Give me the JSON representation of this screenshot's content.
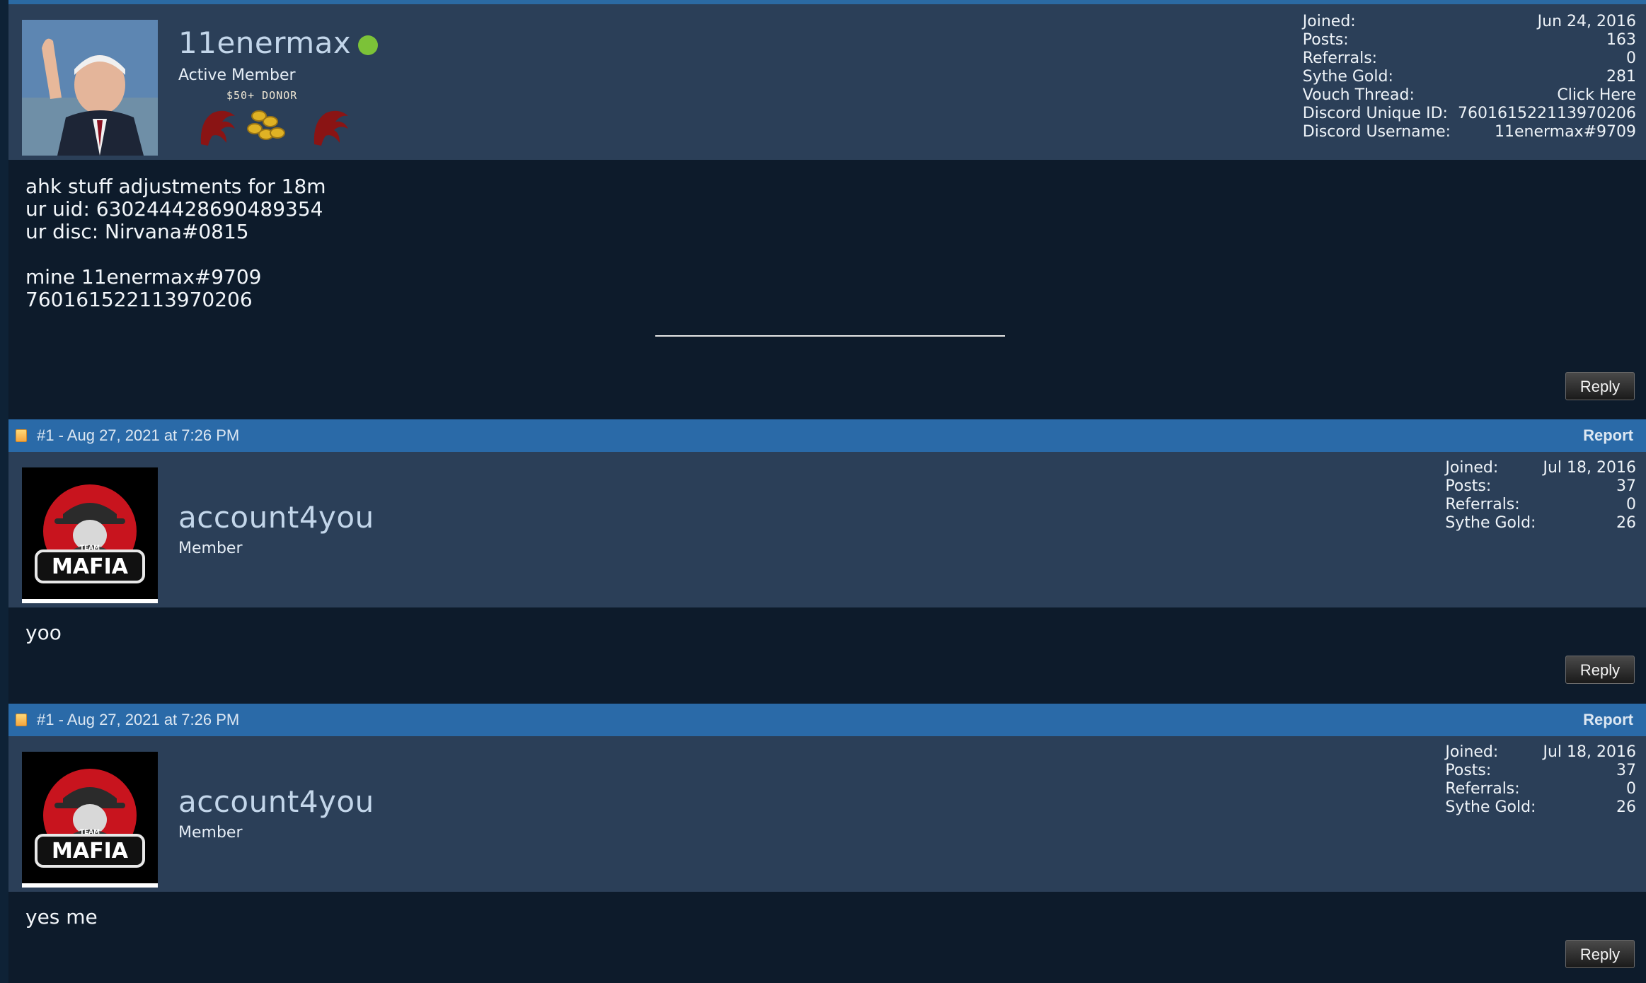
{
  "colors": {
    "header_bar": "#2a6aa8",
    "user_panel": "#2b3f58",
    "post_body": "#0d1b2b",
    "online": "#7cc238",
    "username": "#c3d6ea"
  },
  "posts": [
    {
      "author": {
        "username": "11enermax",
        "title": "Active Member",
        "online": true,
        "donor_label": "$50+ DONOR",
        "avatar_icon": "avatar-photo-icon",
        "stats": [
          {
            "label": "Joined:",
            "value": "Jun 24, 2016"
          },
          {
            "label": "Posts:",
            "value": "163"
          },
          {
            "label": "Referrals:",
            "value": "0"
          },
          {
            "label": "Sythe Gold:",
            "value": "281"
          },
          {
            "label": "Vouch Thread:",
            "value": "Click Here"
          },
          {
            "label": "Discord Unique ID:",
            "value": "760161522113970206"
          },
          {
            "label": "Discord Username:",
            "value": "11enermax#9709"
          }
        ]
      },
      "body": "ahk stuff adjustments for 18m\nur uid: 630244428690489354\nur disc: Nirvana#0815\n\nmine 11enermax#9709\n760161522113970206",
      "reply_label": "Reply"
    },
    {
      "header": {
        "meta": "#1 - Aug 27, 2021 at 7:26 PM",
        "report_label": "Report"
      },
      "author": {
        "username": "account4you",
        "title": "Member",
        "avatar_text": "MAFIA",
        "avatar_small_text": "TEAM",
        "stats": [
          {
            "label": "Joined:",
            "value": "Jul 18, 2016"
          },
          {
            "label": "Posts:",
            "value": "37"
          },
          {
            "label": "Referrals:",
            "value": "0"
          },
          {
            "label": "Sythe Gold:",
            "value": "26"
          }
        ]
      },
      "body": "yoo",
      "reply_label": "Reply"
    },
    {
      "header": {
        "meta": "#1 - Aug 27, 2021 at 7:26 PM",
        "report_label": "Report"
      },
      "author": {
        "username": "account4you",
        "title": "Member",
        "avatar_text": "MAFIA",
        "avatar_small_text": "TEAM",
        "stats": [
          {
            "label": "Joined:",
            "value": "Jul 18, 2016"
          },
          {
            "label": "Posts:",
            "value": "37"
          },
          {
            "label": "Referrals:",
            "value": "0"
          },
          {
            "label": "Sythe Gold:",
            "value": "26"
          }
        ]
      },
      "body": "yes me",
      "reply_label": "Reply"
    }
  ]
}
